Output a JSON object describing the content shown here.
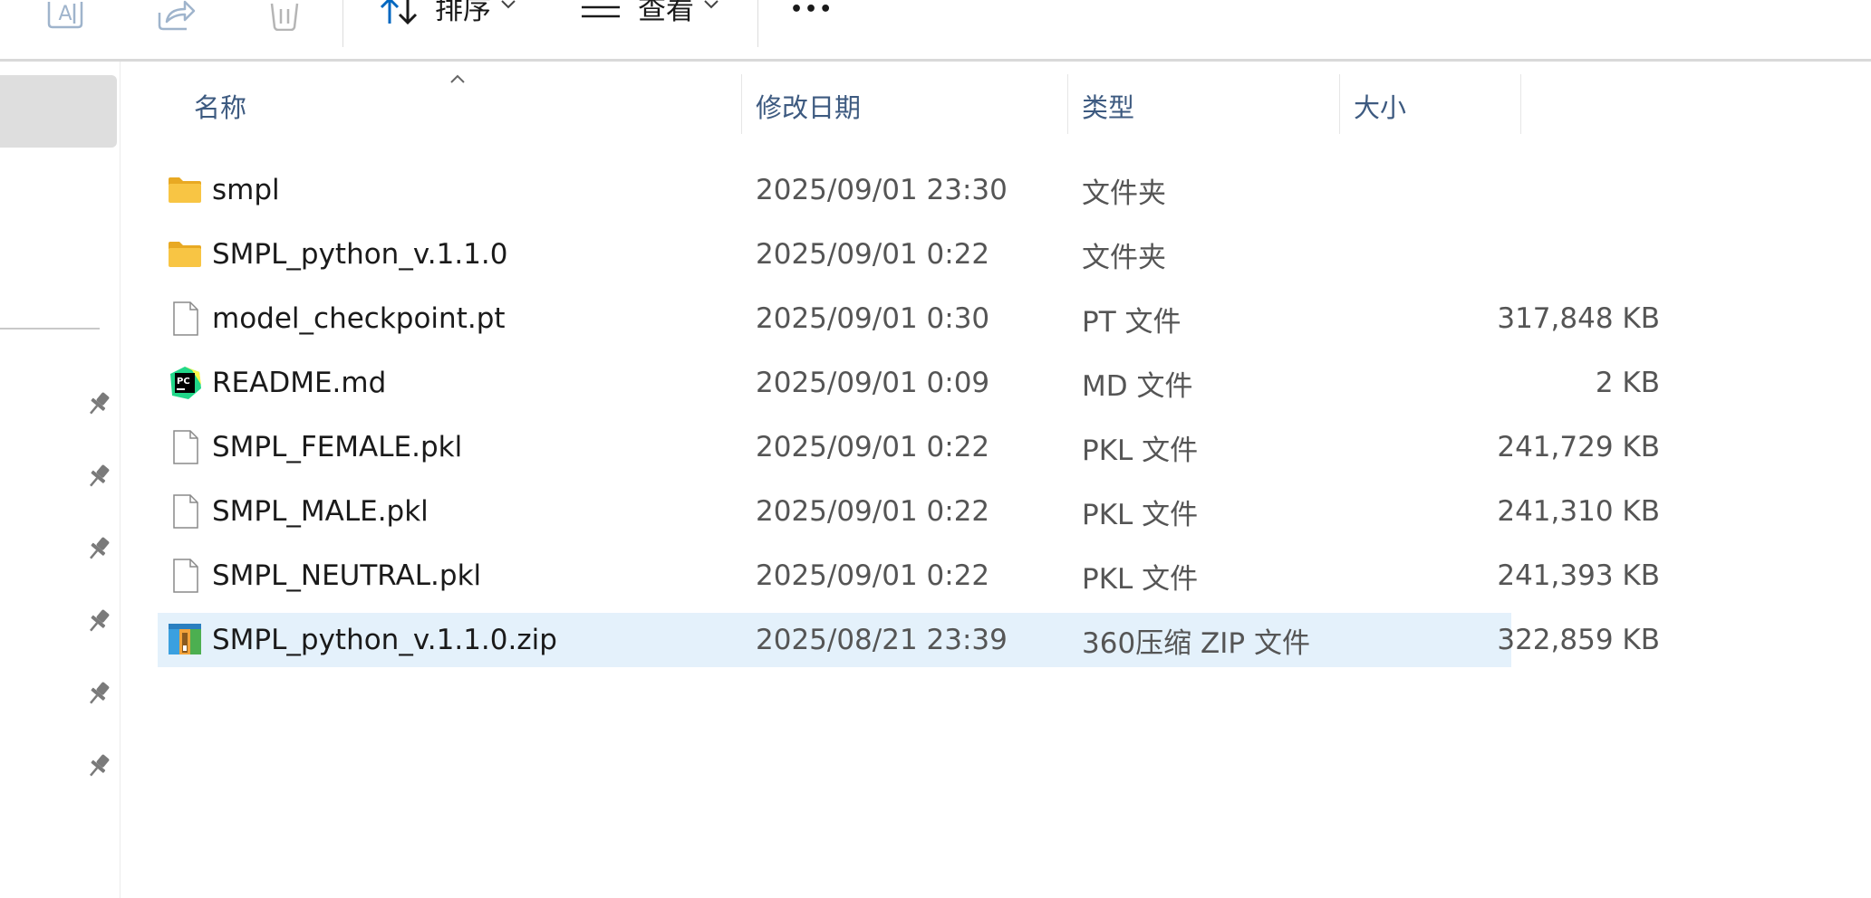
{
  "toolbar": {
    "sort_label": "排序",
    "view_label": "查看",
    "more_label": "•••"
  },
  "columns": {
    "name": "名称",
    "date": "修改日期",
    "type": "类型",
    "size": "大小"
  },
  "files": [
    {
      "name": "smpl",
      "date": "2025/09/01 23:30",
      "type": "文件夹",
      "size": "",
      "icon": "folder-icon"
    },
    {
      "name": "SMPL_python_v.1.1.0",
      "date": "2025/09/01 0:22",
      "type": "文件夹",
      "size": "",
      "icon": "folder-icon"
    },
    {
      "name": "model_checkpoint.pt",
      "date": "2025/09/01 0:30",
      "type": "PT 文件",
      "size": "317,848 KB",
      "icon": "generic-file-icon"
    },
    {
      "name": "README.md",
      "date": "2025/09/01 0:09",
      "type": "MD 文件",
      "size": "2 KB",
      "icon": "pycharm-file-icon"
    },
    {
      "name": "SMPL_FEMALE.pkl",
      "date": "2025/09/01 0:22",
      "type": "PKL 文件",
      "size": "241,729 KB",
      "icon": "generic-file-icon"
    },
    {
      "name": "SMPL_MALE.pkl",
      "date": "2025/09/01 0:22",
      "type": "PKL 文件",
      "size": "241,310 KB",
      "icon": "generic-file-icon"
    },
    {
      "name": "SMPL_NEUTRAL.pkl",
      "date": "2025/09/01 0:22",
      "type": "PKL 文件",
      "size": "241,393 KB",
      "icon": "generic-file-icon"
    },
    {
      "name": "SMPL_python_v.1.1.0.zip",
      "date": "2025/08/21 23:39",
      "type": "360压缩 ZIP 文件",
      "size": "322,859 KB",
      "icon": "zip-archive-icon",
      "selected": true
    }
  ],
  "colors": {
    "accent": "#0067c0",
    "selection": "#e4f1fb",
    "folder": "#f8c544"
  }
}
